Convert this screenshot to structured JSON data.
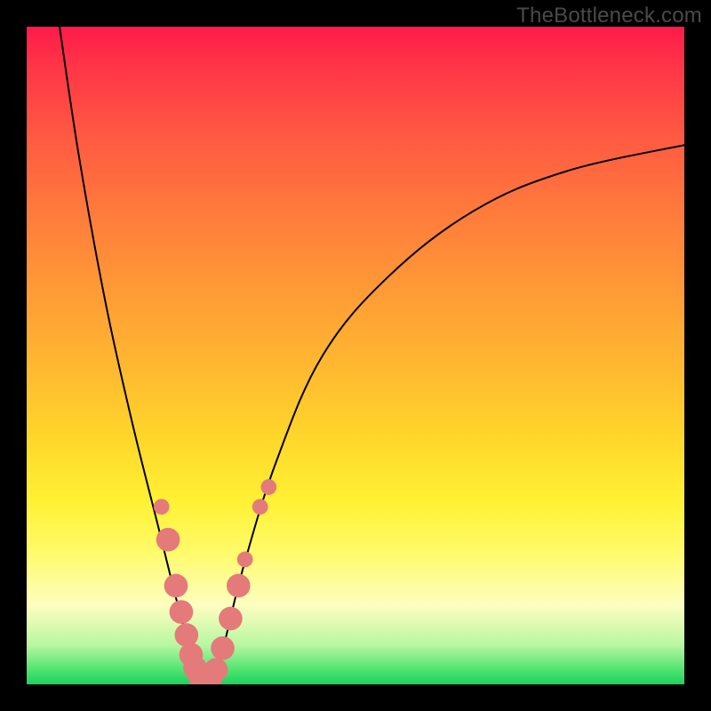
{
  "watermark": "TheBottleneck.com",
  "chart_data": {
    "type": "line",
    "title": "",
    "xlabel": "",
    "ylabel": "",
    "xlim": [
      0,
      100
    ],
    "ylim": [
      0,
      100
    ],
    "gradient_stops": [
      {
        "pos": 0,
        "color": "#ff1a4a"
      },
      {
        "pos": 16,
        "color": "#ff5742"
      },
      {
        "pos": 40,
        "color": "#ff9a36"
      },
      {
        "pos": 62,
        "color": "#ffd52a"
      },
      {
        "pos": 80,
        "color": "#fffb6a"
      },
      {
        "pos": 94,
        "color": "#b8f7a1"
      },
      {
        "pos": 100,
        "color": "#18d45f"
      }
    ],
    "series": [
      {
        "name": "left-arm",
        "stroke": "#000000",
        "points": [
          {
            "x": 5,
            "y": 100
          },
          {
            "x": 8,
            "y": 80
          },
          {
            "x": 12,
            "y": 58
          },
          {
            "x": 16,
            "y": 40
          },
          {
            "x": 20,
            "y": 24
          },
          {
            "x": 23,
            "y": 12
          },
          {
            "x": 25,
            "y": 5
          },
          {
            "x": 26.5,
            "y": 1
          }
        ]
      },
      {
        "name": "right-arm",
        "stroke": "#000000",
        "points": [
          {
            "x": 28.5,
            "y": 1
          },
          {
            "x": 30,
            "y": 6
          },
          {
            "x": 33,
            "y": 18
          },
          {
            "x": 38,
            "y": 34
          },
          {
            "x": 45,
            "y": 50
          },
          {
            "x": 55,
            "y": 62
          },
          {
            "x": 68,
            "y": 72
          },
          {
            "x": 82,
            "y": 78
          },
          {
            "x": 100,
            "y": 82
          }
        ]
      }
    ],
    "markers": {
      "color": "#e57a7a",
      "radius_small": 1.2,
      "radius_large": 1.8,
      "points": [
        {
          "x": 20.5,
          "y": 27,
          "r": "small"
        },
        {
          "x": 21.5,
          "y": 22,
          "r": "large"
        },
        {
          "x": 22.7,
          "y": 15,
          "r": "large"
        },
        {
          "x": 23.5,
          "y": 11,
          "r": "large"
        },
        {
          "x": 24.3,
          "y": 7.5,
          "r": "large"
        },
        {
          "x": 25.0,
          "y": 4.5,
          "r": "large"
        },
        {
          "x": 25.6,
          "y": 2.5,
          "r": "large"
        },
        {
          "x": 26.3,
          "y": 1.2,
          "r": "large"
        },
        {
          "x": 27.2,
          "y": 0.8,
          "r": "large"
        },
        {
          "x": 28.0,
          "y": 1.0,
          "r": "large"
        },
        {
          "x": 28.8,
          "y": 2.2,
          "r": "large"
        },
        {
          "x": 29.8,
          "y": 5.5,
          "r": "large"
        },
        {
          "x": 31.0,
          "y": 10,
          "r": "large"
        },
        {
          "x": 32.2,
          "y": 15,
          "r": "large"
        },
        {
          "x": 33.2,
          "y": 19,
          "r": "small"
        },
        {
          "x": 35.5,
          "y": 27,
          "r": "small"
        },
        {
          "x": 36.8,
          "y": 30,
          "r": "small"
        }
      ]
    }
  }
}
